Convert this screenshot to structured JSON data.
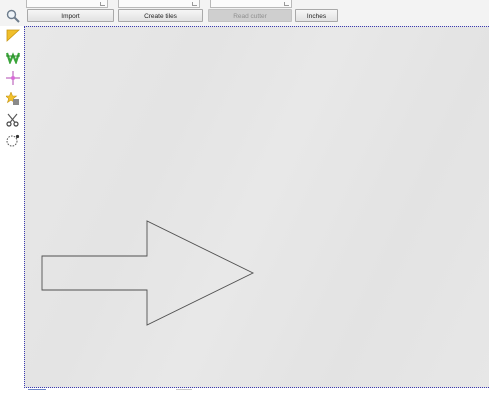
{
  "toolbar": {
    "import_label": "Import",
    "create_tiles_label": "Create tiles",
    "read_cutter_label": "Read cutter",
    "units_label": "Inches"
  },
  "tools": [
    {
      "name": "zoom-tool",
      "icon": "magnifier-icon"
    },
    {
      "name": "pointer-tool",
      "icon": "yellow-pointer-icon"
    },
    {
      "name": "weed-tool",
      "icon": "green-w-icon"
    },
    {
      "name": "node-tool",
      "icon": "crosshair-node-icon"
    },
    {
      "name": "star-tool",
      "icon": "star-shape-icon"
    },
    {
      "name": "cut-tool",
      "icon": "scissors-icon"
    },
    {
      "name": "lasso-tool",
      "icon": "lasso-icon"
    }
  ],
  "canvas": {
    "shape": "arrow",
    "background": "#e6e6e6",
    "selection_border_color": "#3b3bb2"
  }
}
